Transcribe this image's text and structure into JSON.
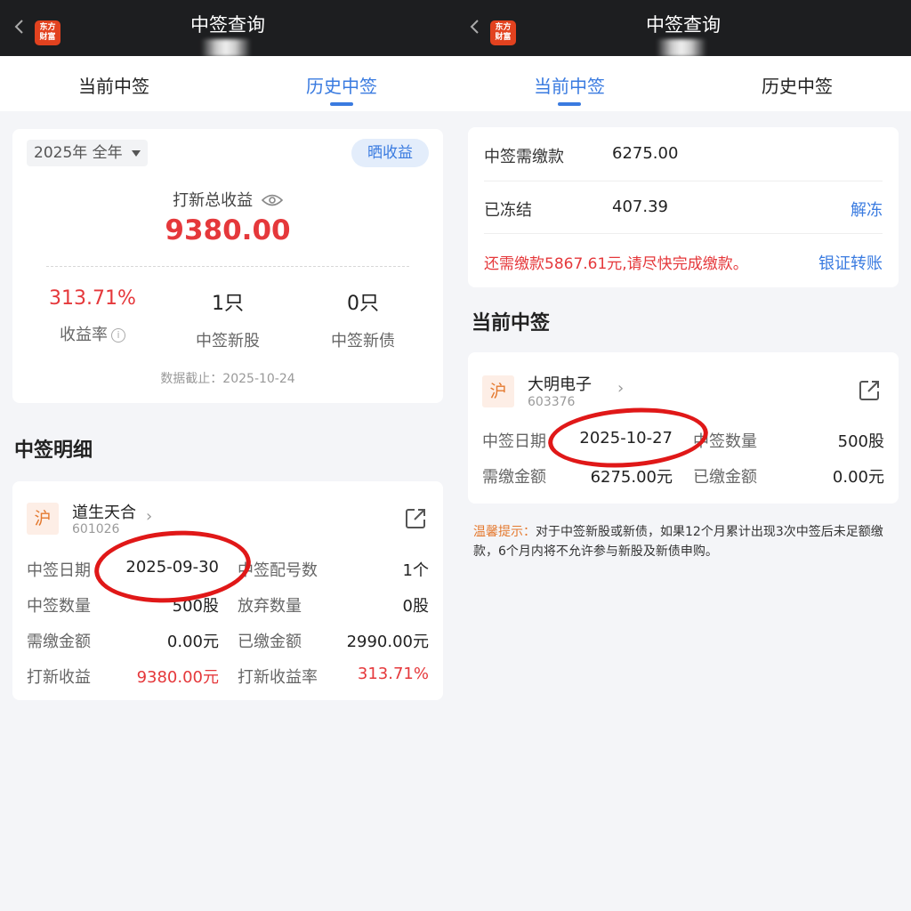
{
  "app": {
    "title": "中签查询",
    "logo_text_1": "东方",
    "logo_text_2": "财富",
    "brand_color": "#e2421f",
    "accent": "#3a7be0",
    "red": "#e5383b"
  },
  "tabs": [
    "当前中签",
    "历史中签"
  ],
  "left": {
    "active_tab": 1,
    "year_filter": "2025年 全年",
    "share_button": "晒收益",
    "total_label": "打新总收益",
    "total_value": "9380.00",
    "stats": [
      {
        "value": "313.71%",
        "label": "收益率"
      },
      {
        "value": "1只",
        "label": "中签新股"
      },
      {
        "value": "0只",
        "label": "中签新债"
      }
    ],
    "data_date": "数据截止：2025-10-24",
    "detail_title": "中签明细",
    "stock": {
      "exchange": "沪",
      "name": "道生天合",
      "code": "601026",
      "rows": [
        [
          {
            "label": "中签日期",
            "value": "2025-09-30"
          },
          {
            "label": "中签配号数",
            "value": "1个"
          }
        ],
        [
          {
            "label": "中签数量",
            "value": "500股"
          },
          {
            "label": "放弃数量",
            "value": "0股"
          }
        ],
        [
          {
            "label": "需缴金额",
            "value": "0.00元"
          },
          {
            "label": "已缴金额",
            "value": "2990.00元"
          }
        ],
        [
          {
            "label": "打新收益",
            "value": "9380.00元"
          },
          {
            "label": "打新收益率",
            "value": "313.71%"
          }
        ]
      ]
    }
  },
  "right": {
    "active_tab": 0,
    "payment": {
      "due_label": "中签需缴款",
      "due_value": "6275.00",
      "frozen_label": "已冻结",
      "frozen_value": "407.39",
      "unfreeze_link": "解冻",
      "warning": "还需缴款5867.61元,请尽快完成缴款。",
      "transfer_link": "银证转账"
    },
    "current_title": "当前中签",
    "stock": {
      "exchange": "沪",
      "name": "大明电子",
      "code": "603376",
      "rows": [
        [
          {
            "label": "中签日期",
            "value": "2025-10-27"
          },
          {
            "label": "中签数量",
            "value": "500股"
          }
        ],
        [
          {
            "label": "需缴金额",
            "value": "6275.00元"
          },
          {
            "label": "已缴金额",
            "value": "0.00元"
          }
        ]
      ]
    },
    "tip_head": "温馨提示：",
    "tip_body": "对于中签新股或新债，如果12个月累计出现3次中签后未足额缴款，6个月内将不允许参与新股及新债申购。"
  }
}
